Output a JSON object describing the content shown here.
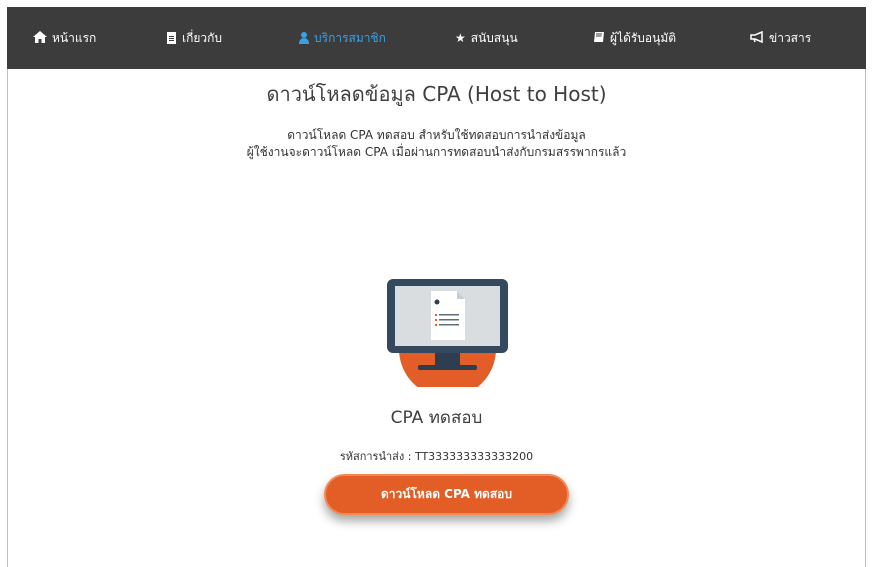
{
  "nav": {
    "items": [
      {
        "label": "หน้าแรก",
        "icon": "home-icon"
      },
      {
        "label": "เกี่ยวกับ",
        "icon": "document-icon"
      },
      {
        "label": "บริการสมาชิก",
        "icon": "user-icon",
        "active": true
      },
      {
        "label": "สนับสนุน",
        "icon": "star-icon"
      },
      {
        "label": "ผู้ได้รับอนุมัติ",
        "icon": "book-icon"
      },
      {
        "label": "ข่าวสาร",
        "icon": "megaphone-icon"
      }
    ]
  },
  "page": {
    "title": "ดาวน์โหลดข้อมูล CPA (Host to Host)",
    "desc_line1": "ดาวน์โหลด CPA ทดสอบ สำหรับใช้ทดสอบการนำส่งข้อมูล",
    "desc_line2": "ผู้ใช้งานจะดาวน์โหลด CPA เมื่อผ่านการทดสอบนำส่งกับกรมสรรพากรแล้ว"
  },
  "card": {
    "icon": "monitor-document-icon",
    "title": "CPA ทดสอบ",
    "code_label": "รหัสการนำส่ง : ",
    "code_value": "TT333333333333200",
    "button_label": "ดาวน์โหลด CPA ทดสอบ"
  },
  "colors": {
    "navbar_bg": "#3c3c3c",
    "active_nav": "#3aa0e6",
    "button_bg": "#e35d26",
    "monitor_frame": "#34495e",
    "monitor_base": "#e35d26"
  }
}
